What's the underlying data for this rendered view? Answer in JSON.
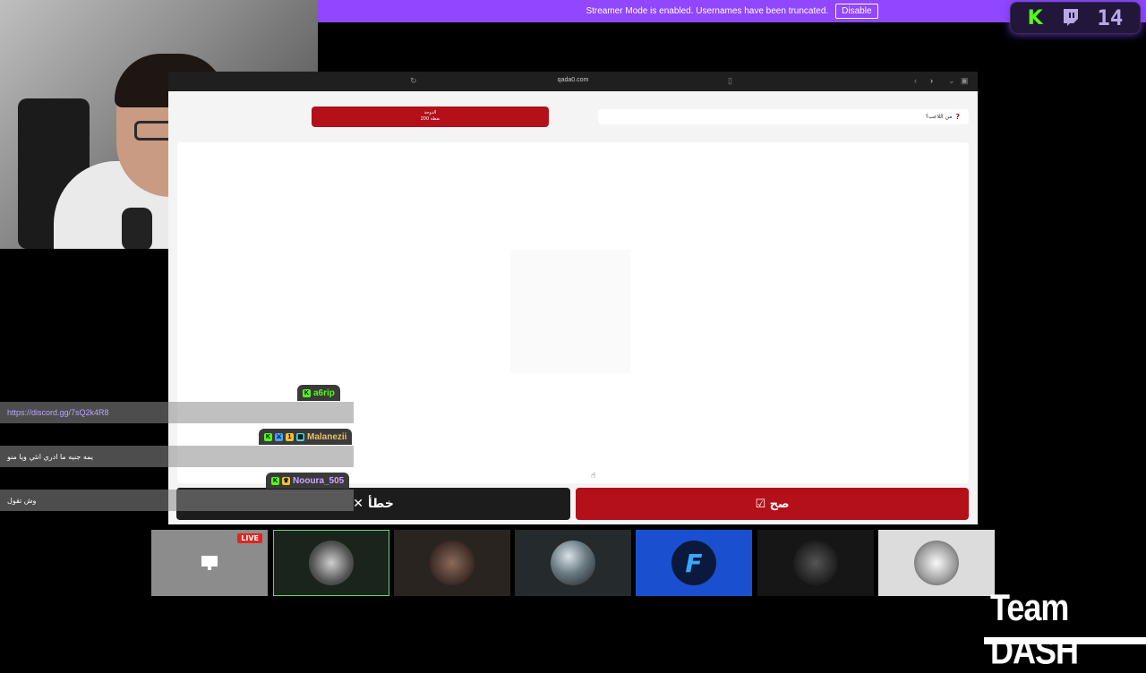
{
  "banner": {
    "message": "Streamer Mode is enabled. Usernames have been truncated.",
    "disable_label": "Disable"
  },
  "viewer_badge": {
    "kick_letter": "K",
    "count": "14"
  },
  "browser": {
    "url": "qada0.com",
    "player": {
      "line1": "الدوحة",
      "line2": "200 نقطة"
    },
    "question": "من اللاعب؟",
    "wrong_label": "✕ خطأ",
    "right_label": "☑ صح"
  },
  "chat": [
    {
      "user": "a6rip",
      "message": "https://discord.gg/7sQ2k4R8",
      "user_color": "#53fc18"
    },
    {
      "user": "Malanezii",
      "message": "يمه جنيه ما ادري انثي ويا منو",
      "user_color": "#e8c06a"
    },
    {
      "user": "Nooura_505",
      "message": "وش تقول",
      "user_color": "#c9a7ff"
    }
  ],
  "thumbnails": {
    "live_label": "LIVE"
  },
  "team_label": "Team DASH",
  "colors": {
    "twitch_purple": "#9146ff",
    "kick_green": "#53fc18",
    "accent_red": "#b3101a"
  }
}
